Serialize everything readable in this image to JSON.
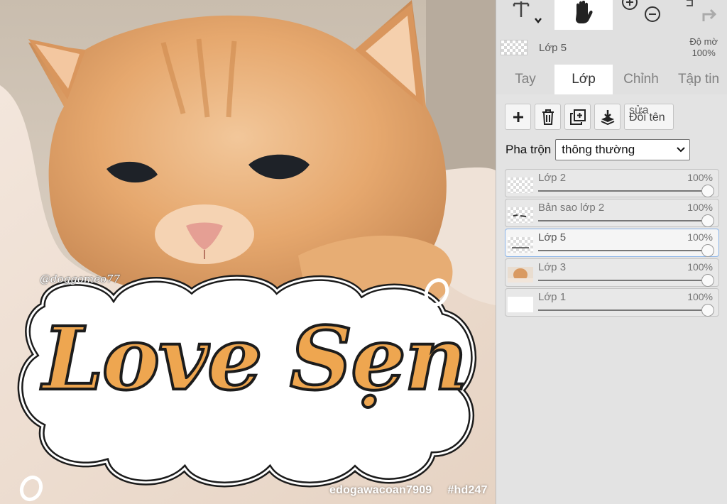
{
  "canvas": {
    "image_subject": "orange-tabby-cat-photo",
    "sticker_text": "Love Sẹn",
    "watermark_top": "@doggomeo77",
    "watermark_bottom_user": "edogawacoan7909",
    "watermark_bottom_tag": "#hd247",
    "colors": {
      "sticker_fill": "#eea650",
      "sticker_outline": "#1c1c1c",
      "cloud": "#ffffff"
    }
  },
  "toolbar": {
    "tools": [
      "text-tool-icon",
      "hand-tool-icon",
      "zoom-in-icon",
      "zoom-out-icon",
      "undo-icon",
      "redo-icon"
    ]
  },
  "layer_info": {
    "name": "Lớp 5",
    "opacity_label": "Độ mờ",
    "opacity_value": "100%"
  },
  "tabs": [
    {
      "label": "Tay",
      "active": false
    },
    {
      "label": "Lớp",
      "active": true
    },
    {
      "label": "Chỉnh",
      "active": false
    },
    {
      "label": "Tập tin",
      "active": false
    }
  ],
  "layer_actions": {
    "add": "plus-icon",
    "delete": "trash-icon",
    "duplicate": "duplicate-icon",
    "merge_down": "merge-down-icon",
    "rename_line1": "sửa",
    "rename_line2": "Đổi tên"
  },
  "blend": {
    "label": "Pha trộn",
    "value": "thông thường"
  },
  "layers": [
    {
      "name": "Lớp 2",
      "opacity": "100%",
      "opacity_fraction": 1.0,
      "selected": false,
      "thumb": "transparent"
    },
    {
      "name": "Bản sao lớp 2",
      "opacity": "100%",
      "opacity_fraction": 1.0,
      "selected": false,
      "thumb": "transparent"
    },
    {
      "name": "Lớp 5",
      "opacity": "100%",
      "opacity_fraction": 1.0,
      "selected": true,
      "thumb": "transparent"
    },
    {
      "name": "Lớp 3",
      "opacity": "100%",
      "opacity_fraction": 1.0,
      "selected": false,
      "thumb": "cat"
    },
    {
      "name": "Lớp 1",
      "opacity": "100%",
      "opacity_fraction": 1.0,
      "selected": false,
      "thumb": "white"
    }
  ],
  "colors": {
    "panel_bg": "#e0e0e0",
    "active_tab_bg": "#ffffff",
    "selected_layer_border": "#8ab4e8"
  }
}
